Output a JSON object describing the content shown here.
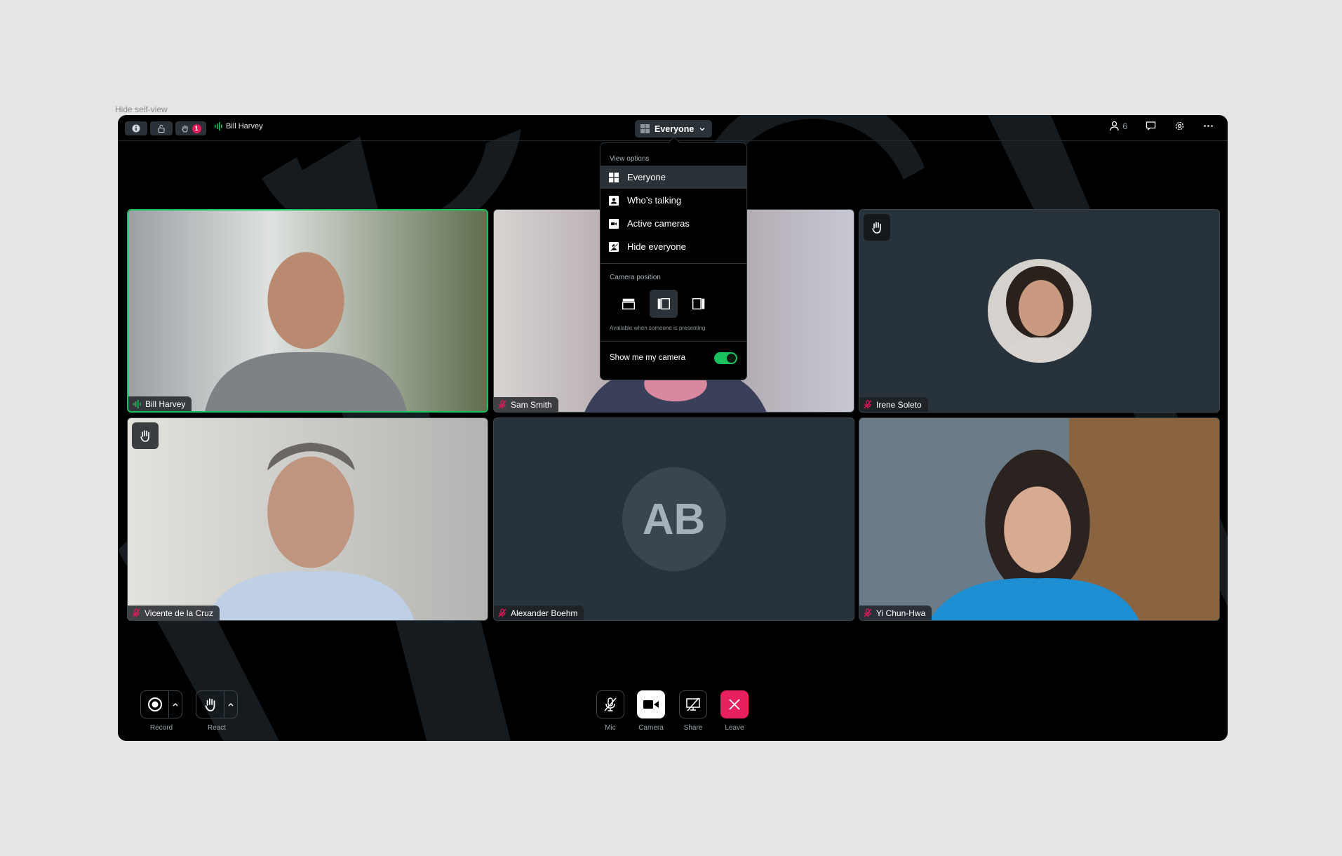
{
  "caption": "Hide self-view",
  "topbar": {
    "raised_hands_count": "1",
    "active_speaker": "Bill Harvey",
    "view_selector_label": "Everyone",
    "participants_count": "6",
    "icons": [
      "info-icon",
      "lock-icon",
      "hand-icon",
      "audio-level-icon",
      "grid-icon",
      "chevron-down-icon",
      "person-icon",
      "chat-icon",
      "gear-icon",
      "more-icon"
    ]
  },
  "view_menu": {
    "view_options_label": "View options",
    "items": [
      {
        "label": "Everyone",
        "icon": "grid-icon",
        "selected": true
      },
      {
        "label": "Who’s talking",
        "icon": "speaker-view-icon",
        "selected": false
      },
      {
        "label": "Active cameras",
        "icon": "camera-icon",
        "selected": false
      },
      {
        "label": "Hide everyone",
        "icon": "hide-person-icon",
        "selected": false
      }
    ],
    "camera_position_label": "Camera position",
    "camera_positions": [
      {
        "name": "top",
        "selected": false
      },
      {
        "name": "left",
        "selected": true
      },
      {
        "name": "right",
        "selected": false
      }
    ],
    "camera_position_note": "Available when someone is presenting",
    "show_my_camera_label": "Show me my camera",
    "show_my_camera_on": true
  },
  "participants": [
    {
      "name": "Bill Harvey",
      "status": "speaking",
      "active": true,
      "hand_raised": false,
      "view": "video"
    },
    {
      "name": "Sam Smith",
      "status": "muted",
      "active": false,
      "hand_raised": false,
      "view": "video"
    },
    {
      "name": "Irene Soleto",
      "status": "muted",
      "active": false,
      "hand_raised": true,
      "view": "avatar"
    },
    {
      "name": "Vicente de la Cruz",
      "status": "muted",
      "active": false,
      "hand_raised": true,
      "view": "video"
    },
    {
      "name": "Alexander Boehm",
      "initials": "AB",
      "status": "muted",
      "active": false,
      "hand_raised": false,
      "view": "initials"
    },
    {
      "name": "Yi Chun-Hwa",
      "status": "muted",
      "active": false,
      "hand_raised": false,
      "view": "video"
    }
  ],
  "controls": {
    "record": "Record",
    "react": "React",
    "mic": "Mic",
    "camera": "Camera",
    "share": "Share",
    "leave": "Leave"
  },
  "colors": {
    "accent_green": "#19c15f",
    "muted_pink": "#e8185a",
    "leave_red": "#e8215e",
    "tile_bg": "#28323a"
  }
}
